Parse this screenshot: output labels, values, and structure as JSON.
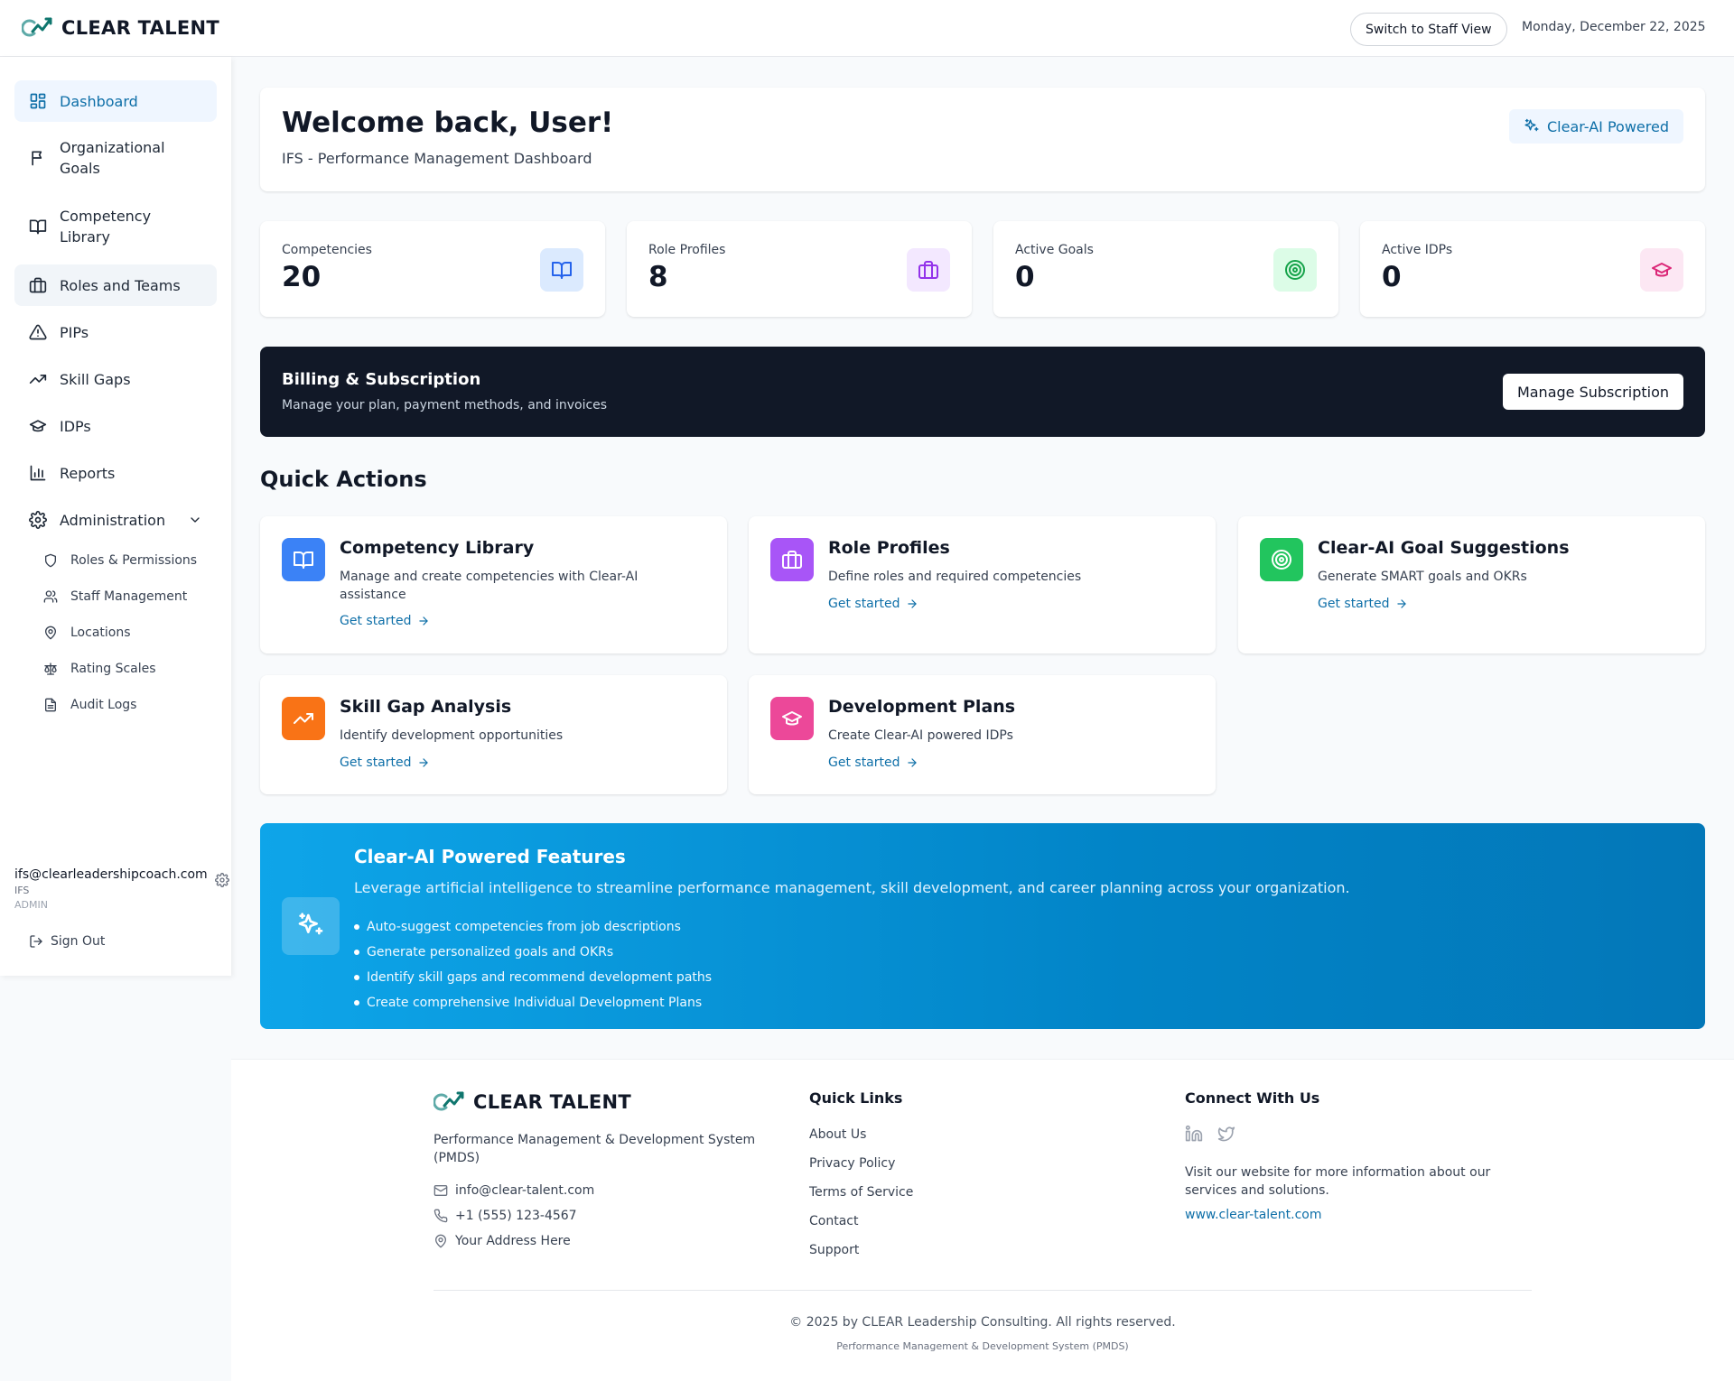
{
  "brand": {
    "name": "CLEAR TALENT"
  },
  "header": {
    "switch_view_label": "Switch to Staff View",
    "date": "Monday, December 22, 2025"
  },
  "sidebar": {
    "items": [
      {
        "label": "Dashboard",
        "icon": "dashboard-grid-icon"
      },
      {
        "label": "Organizational Goals",
        "icon": "flag-icon"
      },
      {
        "label": "Competency Library",
        "icon": "book-icon"
      },
      {
        "label": "Roles and Teams",
        "icon": "briefcase-icon"
      },
      {
        "label": "PIPs",
        "icon": "warning-triangle-icon"
      },
      {
        "label": "Skill Gaps",
        "icon": "trending-up-icon"
      },
      {
        "label": "IDPs",
        "icon": "graduation-cap-icon"
      },
      {
        "label": "Reports",
        "icon": "bar-chart-icon"
      },
      {
        "label": "Administration",
        "icon": "gear-icon"
      }
    ],
    "admin_items": [
      {
        "label": "Roles & Permissions",
        "icon": "shield-icon"
      },
      {
        "label": "Staff Management",
        "icon": "users-icon"
      },
      {
        "label": "Locations",
        "icon": "map-pin-icon"
      },
      {
        "label": "Rating Scales",
        "icon": "scale-icon"
      },
      {
        "label": "Audit Logs",
        "icon": "file-text-icon"
      }
    ],
    "user": {
      "email": "ifs@clearleadershipcoach.com",
      "org": "IFS",
      "role": "ADMIN"
    },
    "sign_out_label": "Sign Out"
  },
  "welcome": {
    "title": "Welcome back, User!",
    "subtitle": "IFS - Performance Management Dashboard",
    "badge": "Clear-AI Powered"
  },
  "stats": [
    {
      "label": "Competencies",
      "value": "20",
      "icon": "book-icon",
      "color": "#2563eb",
      "bg": "#dbeafe"
    },
    {
      "label": "Role Profiles",
      "value": "8",
      "icon": "briefcase-icon",
      "color": "#9333ea",
      "bg": "#f3e8ff"
    },
    {
      "label": "Active Goals",
      "value": "0",
      "icon": "target-icon",
      "color": "#16a34a",
      "bg": "#dcfce7"
    },
    {
      "label": "Active IDPs",
      "value": "0",
      "icon": "graduation-cap-icon",
      "color": "#db2777",
      "bg": "#fce7f3"
    }
  ],
  "billing": {
    "title": "Billing & Subscription",
    "subtitle": "Manage your plan, payment methods, and invoices",
    "button": "Manage Subscription"
  },
  "quick_actions": {
    "title": "Quick Actions",
    "cta": "Get started",
    "items": [
      {
        "title": "Competency Library",
        "desc": "Manage and create competencies with Clear-AI assistance",
        "icon": "book-icon",
        "color": "#3b82f6"
      },
      {
        "title": "Role Profiles",
        "desc": "Define roles and required competencies",
        "icon": "briefcase-icon",
        "color": "#a855f7"
      },
      {
        "title": "Clear-AI Goal Suggestions",
        "desc": "Generate SMART goals and OKRs",
        "icon": "target-icon",
        "color": "#22c55e"
      },
      {
        "title": "Skill Gap Analysis",
        "desc": "Identify development opportunities",
        "icon": "trending-up-icon",
        "color": "#f97316"
      },
      {
        "title": "Development Plans",
        "desc": "Create Clear-AI powered IDPs",
        "icon": "graduation-cap-icon",
        "color": "#ec4899"
      }
    ]
  },
  "ai_features": {
    "title": "Clear-AI Powered Features",
    "desc": "Leverage artificial intelligence to streamline performance management, skill development, and career planning across your organization.",
    "bullets": [
      "Auto-suggest competencies from job descriptions",
      "Generate personalized goals and OKRs",
      "Identify skill gaps and recommend development paths",
      "Create comprehensive Individual Development Plans"
    ]
  },
  "footer": {
    "desc": "Performance Management & Development System (PMDS)",
    "email": "info@clear-talent.com",
    "phone": "+1 (555) 123-4567",
    "address": "Your Address Here",
    "quick_links_title": "Quick Links",
    "links": [
      "About Us",
      "Privacy Policy",
      "Terms of Service",
      "Contact",
      "Support"
    ],
    "connect_title": "Connect With Us",
    "visit_text": "Visit our website for more information about our services and solutions.",
    "website": "www.clear-talent.com",
    "copyright": "© 2025 by CLEAR Leadership Consulting. All rights reserved.",
    "system": "Performance Management & Development System (PMDS)"
  }
}
